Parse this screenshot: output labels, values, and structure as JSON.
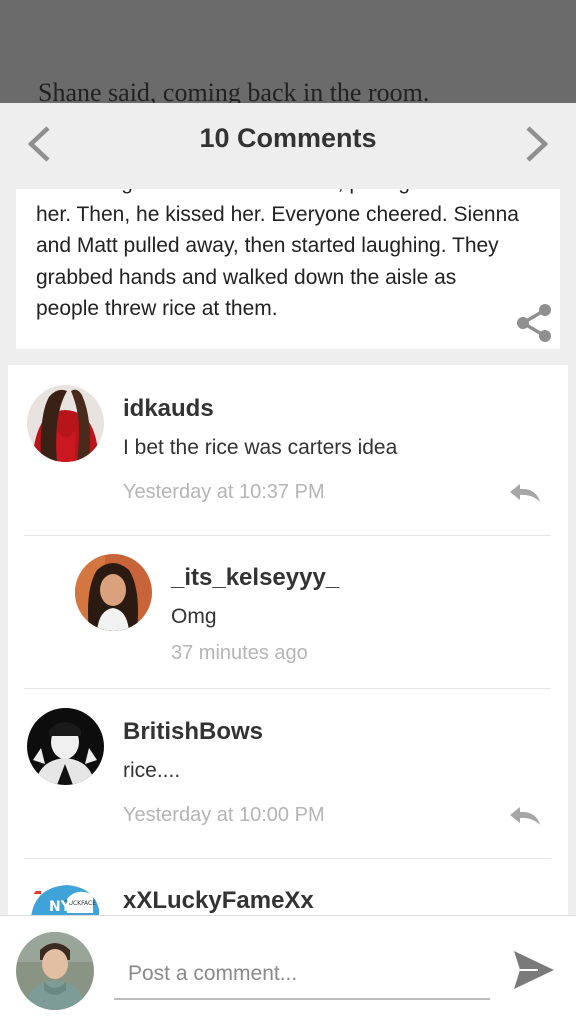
{
  "story": {
    "top_line": "Shane said, coming back in the room.",
    "cut_line": "Matthew grabbed Sienna's waist, pulling him to",
    "excerpt_lines": [
      "her. Then, he kissed her. Everyone cheered. Sienna",
      "and Matt pulled away, then started laughing. They",
      "grabbed hands and walked down the aisle as",
      "people threw rice at them."
    ]
  },
  "header": {
    "title": "10 Comments"
  },
  "comments": [
    {
      "username": "idkauds",
      "text": "I bet the rice was carters idea",
      "time": "Yesterday at 10:37 PM"
    },
    {
      "username": "_its_kelseyyy_",
      "text": "Omg",
      "time": "37 minutes ago"
    },
    {
      "username": "BritishBows",
      "text": "rice....",
      "time": "Yesterday at 10:00 PM"
    },
    {
      "username": "xXLuckyFameXx",
      "avatar_text": "DUCKFACE"
    }
  ],
  "composer": {
    "placeholder": "Post a comment..."
  },
  "icons": [
    "back-chevron-icon",
    "forward-chevron-icon",
    "share-icon",
    "reply-icon",
    "send-icon"
  ],
  "colors": {
    "header_bg": "#eeeeee",
    "timestamp": "#b5b5b5",
    "icon": "#8f8f8f"
  }
}
